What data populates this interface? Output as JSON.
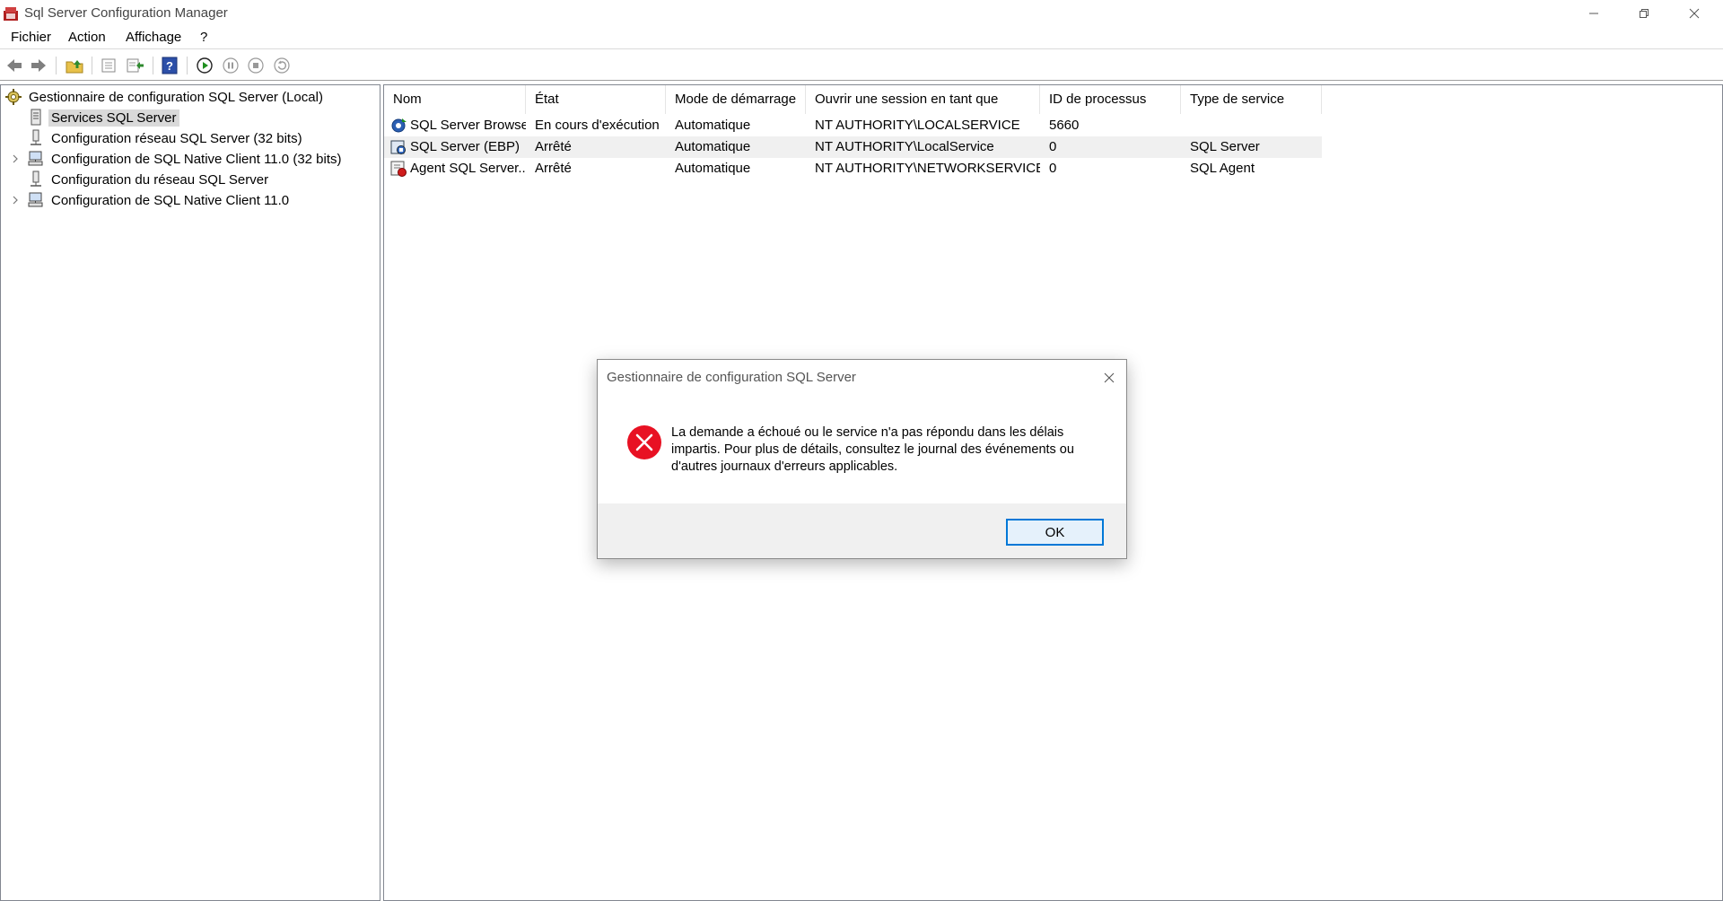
{
  "window": {
    "title": "Sql Server Configuration Manager"
  },
  "menu": {
    "items": [
      "Fichier",
      "Action",
      "Affichage",
      "?"
    ]
  },
  "toolbar": {
    "buttons": [
      "back-arrow-icon",
      "forward-arrow-icon",
      "up-folder-icon",
      "properties-icon",
      "export-list-icon",
      "help-icon",
      "start-service-icon",
      "pause-service-icon",
      "stop-service-icon",
      "restart-service-icon"
    ]
  },
  "tree": {
    "root": "Gestionnaire de configuration SQL Server (Local)",
    "items": [
      {
        "label": "Services SQL Server",
        "selected": true,
        "expandable": false
      },
      {
        "label": "Configuration réseau SQL Server (32 bits)",
        "selected": false,
        "expandable": false
      },
      {
        "label": "Configuration de SQL Native Client 11.0 (32 bits)",
        "selected": false,
        "expandable": true
      },
      {
        "label": "Configuration du réseau SQL Server",
        "selected": false,
        "expandable": false
      },
      {
        "label": "Configuration de SQL Native Client 11.0",
        "selected": false,
        "expandable": true
      }
    ]
  },
  "list": {
    "columns": [
      "Nom",
      "État",
      "Mode de démarrage",
      "Ouvrir une session en tant que",
      "ID de processus",
      "Type de service"
    ],
    "rows": [
      {
        "name": "SQL Server Browser",
        "state": "En cours d'exécution",
        "start_mode": "Automatique",
        "logon": "NT AUTHORITY\\LOCALSERVICE",
        "pid": "5660",
        "type": ""
      },
      {
        "name": "SQL Server (EBP)",
        "state": "Arrêté",
        "start_mode": "Automatique",
        "logon": "NT AUTHORITY\\LocalService",
        "pid": "0",
        "type": "SQL Server"
      },
      {
        "name": "Agent SQL Server...",
        "state": "Arrêté",
        "start_mode": "Automatique",
        "logon": "NT AUTHORITY\\NETWORKSERVICE",
        "pid": "0",
        "type": "SQL Agent"
      }
    ]
  },
  "dialog": {
    "title": "Gestionnaire de configuration SQL Server",
    "message": "La demande a échoué ou le service n'a pas répondu dans les délais impartis. Pour plus de détails, consultez le journal des événements ou d'autres journaux d'erreurs applicables.",
    "ok_label": "OK",
    "icon": "error-icon"
  },
  "colors": {
    "accent": "#0078d7",
    "error": "#e81123",
    "selection": "#d9d9d9"
  }
}
